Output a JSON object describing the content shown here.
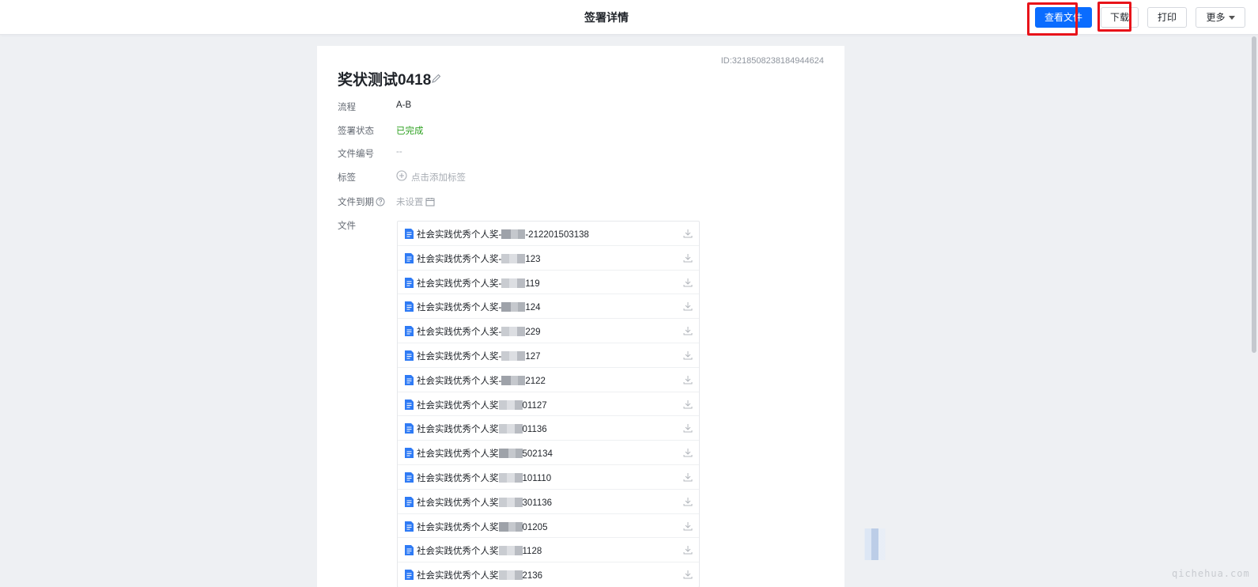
{
  "header": {
    "title": "签署详情",
    "buttons": {
      "view_file": "查看文件",
      "download": "下载",
      "print": "打印",
      "more": "更多"
    }
  },
  "document": {
    "id_text": "ID:3218508238184944624",
    "title": "奖状测试0418",
    "fields": {
      "flow_label": "流程",
      "flow_value": "A-B",
      "status_label": "签署状态",
      "status_value": "已完成",
      "number_label": "文件编号",
      "number_value": "--",
      "tag_label": "标签",
      "tag_add": "点击添加标签",
      "expiry_label": "文件到期",
      "expiry_value": "未设置",
      "files_label": "文件"
    },
    "files": [
      {
        "prefix": "社会实践优秀个人奖-",
        "suffix": "-212201503138"
      },
      {
        "prefix": "社会实践优秀个人奖-",
        "suffix": "123"
      },
      {
        "prefix": "社会实践优秀个人奖-",
        "suffix": "119"
      },
      {
        "prefix": "社会实践优秀个人奖-",
        "suffix": "124"
      },
      {
        "prefix": "社会实践优秀个人奖-",
        "suffix": "229"
      },
      {
        "prefix": "社会实践优秀个人奖-",
        "suffix": "127"
      },
      {
        "prefix": "社会实践优秀个人奖-",
        "suffix": "2122"
      },
      {
        "prefix": "社会实践优秀个人奖",
        "suffix": "01127"
      },
      {
        "prefix": "社会实践优秀个人奖",
        "suffix": "01136"
      },
      {
        "prefix": "社会实践优秀个人奖",
        "suffix": "502134"
      },
      {
        "prefix": "社会实践优秀个人奖",
        "suffix": "101110"
      },
      {
        "prefix": "社会实践优秀个人奖",
        "suffix": "301136"
      },
      {
        "prefix": "社会实践优秀个人奖",
        "suffix": "01205"
      },
      {
        "prefix": "社会实践优秀个人奖",
        "suffix": "1128"
      },
      {
        "prefix": "社会实践优秀个人奖",
        "suffix": "2136"
      }
    ]
  },
  "watermark": "qichehua.com",
  "colors": {
    "primary": "#0a6cff",
    "success": "#2ea121",
    "highlight": "#e8131a"
  }
}
